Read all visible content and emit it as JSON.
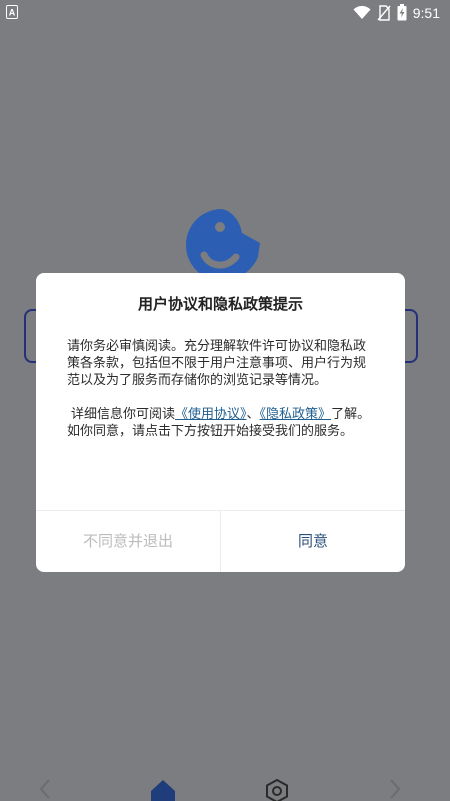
{
  "status_bar": {
    "time": "9:51",
    "icons": [
      "app-notification-icon",
      "wifi-icon",
      "no-sim-icon",
      "battery-charging-icon"
    ]
  },
  "dialog": {
    "title": "用户协议和隐私政策提示",
    "paragraph1": "请你务必审慎阅读。充分理解软件许可协议和隐私政策各条款，包括但不限于用户注意事项、用户行为规范以及为了服务而存储你的浏览记录等情况。",
    "paragraph2_prefix": "详细信息你可阅读",
    "user_agreement_link": "《使用协议》",
    "separator": "、",
    "privacy_policy_link": "《隐私政策》",
    "paragraph2_suffix": "了解。如你同意，请点击下方按钮开始接受我们的服务。",
    "decline_button": "不同意并退出",
    "agree_button": "同意"
  },
  "colors": {
    "overlay": "#7b7d80",
    "link": "#1f5e8f",
    "agree": "#2a4f7a",
    "decline": "#bcbcbc",
    "brand": "#2c5fb3"
  },
  "bottom_nav": {
    "icons": [
      "back-arrow-icon",
      "home-icon",
      "settings-hex-icon",
      "forward-arrow-icon"
    ]
  }
}
